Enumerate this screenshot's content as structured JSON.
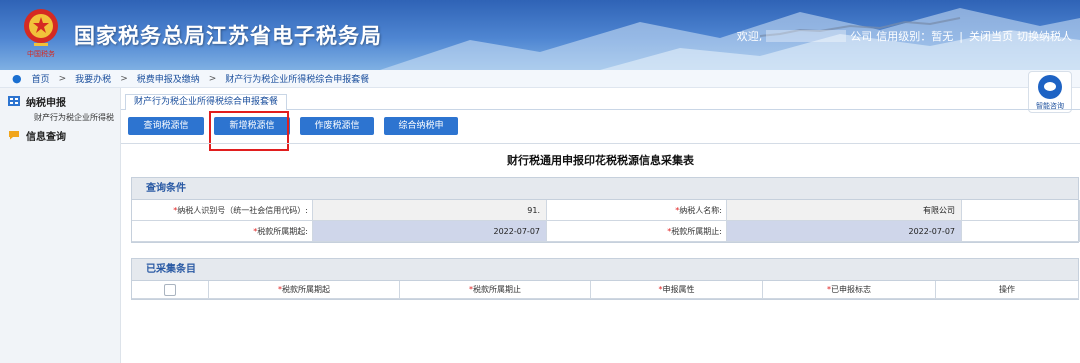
{
  "header": {
    "title": "国家税务总局江苏省电子税务局",
    "emblem_caption": "中国税务",
    "welcome": "欢迎,",
    "company_suffix": "公司",
    "credit_label": "信用级别：暂无",
    "separator": "|",
    "close_page": "关闭当页",
    "switch_taxpayer": "切换纳税人"
  },
  "breadcrumb": {
    "items": [
      "首页",
      "我要办税",
      "税费申报及缴纳",
      "财产行为税企业所得税综合申报套餐"
    ],
    "arrow": ">"
  },
  "help": {
    "label": "智能咨询"
  },
  "sidebar": {
    "groups": [
      {
        "label": "纳税申报",
        "sub": [
          "财产行为税企业所得税"
        ]
      },
      {
        "label": "信息查询",
        "sub": []
      }
    ]
  },
  "tab": {
    "label": "财产行为税企业所得税综合申报套餐"
  },
  "buttons": [
    "查询税源信息",
    "新增税源信息",
    "作废税源信息",
    "综合纳税申报"
  ],
  "form_title": "财行税通用申报印花税税源信息采集表",
  "query": {
    "heading": "查询条件",
    "taxpayer_id_label": "纳税人识别号（统一社会信用代码）:",
    "taxpayer_id_value": "91.",
    "taxpayer_name_label": "纳税人名称:",
    "taxpayer_name_value": "有限公司",
    "period_start_label": "税款所属期起:",
    "period_start_value": "2022-07-07",
    "period_end_label": "税款所属期止:",
    "period_end_value": "2022-07-07",
    "required_mark": "*"
  },
  "collected": {
    "heading": "已采集条目",
    "columns": [
      "税款所属期起",
      "税款所属期止",
      "申报属性",
      "已申报标志",
      "操作"
    ]
  },
  "colors": {
    "accent": "#2d74d0",
    "highlight": "#e11e1e",
    "header_blue": "#2f63b6"
  }
}
